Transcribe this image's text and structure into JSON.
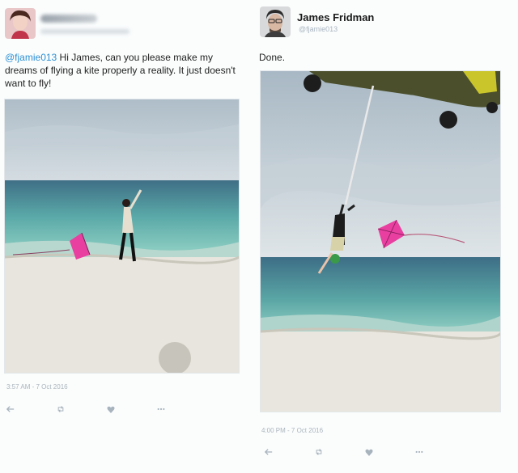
{
  "left_tweet": {
    "text_mention": "@fjamie013",
    "text_body": " Hi James, can you please make my dreams of flying a kite properly a reality. It just doesn't want to fly!",
    "timestamp": "3:57 AM - 7 Oct 2016"
  },
  "right_tweet": {
    "name": "James Fridman",
    "handle": "@fjamie013",
    "text": "Done.",
    "timestamp": "4:00 PM - 7 Oct 2016"
  },
  "actions": [
    "reply-icon",
    "retweet-icon",
    "like-icon",
    "more-icon"
  ],
  "colors": {
    "mention": "#2b8fd3",
    "kite": "#e83fa0",
    "sea": "#5fb3b0",
    "sand": "#e8e6df"
  }
}
